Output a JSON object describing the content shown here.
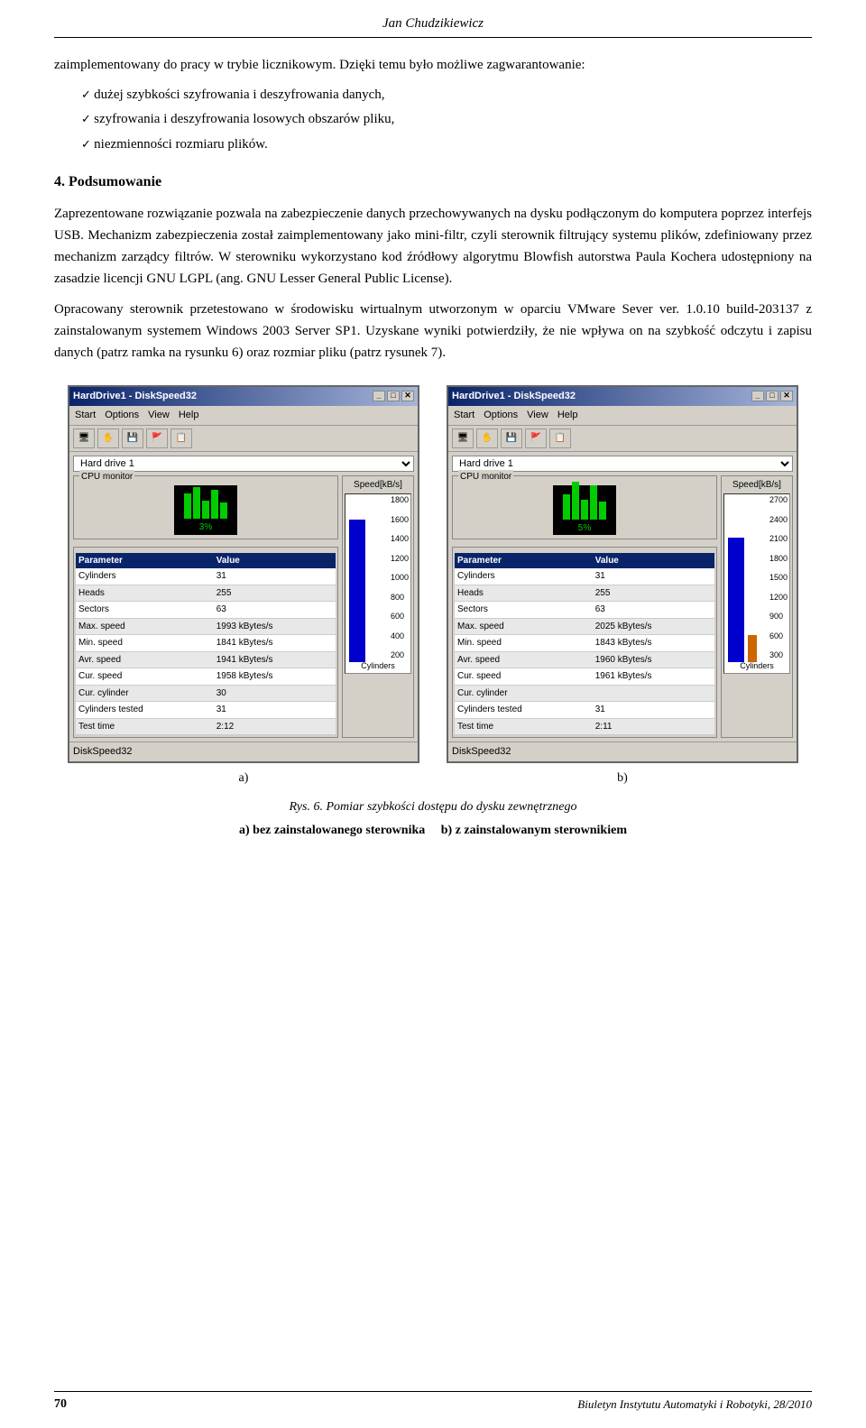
{
  "header": {
    "author": "Jan Chudzikiewicz"
  },
  "intro_text": "zaimplementowany do pracy w trybie licznikowym. Dzięki temu było możliwe zagwarantowanie:",
  "checklist": [
    "dużej szybkości szyfrowania i deszyfrowania danych,",
    "szyfrowania i deszyfrowania losowych obszarów pliku,",
    "niezmienności rozmiaru plików."
  ],
  "section": {
    "number": "4.",
    "title": "Podsumowanie"
  },
  "paragraphs": [
    "Zaprezentowane rozwiązanie pozwala na zabezpieczenie danych przechowywanych na dysku podłączonym do komputera poprzez interfejs USB. Mechanizm zabezpieczenia został zaimplementowany jako mini-filtr, czyli sterownik filtrujący systemu plików, zdefiniowany przez mechanizm zarządcy filtrów. W sterowniku wykorzystano kod źródłowy algorytmu Blowfish autorstwa Paula Kochera udostępniony na zasadzie licencji GNU LGPL (ang. GNU Lesser General Public License).",
    "Opracowany sterownik przetestowano w środowisku wirtualnym utworzonym w oparciu VMware Sever ver. 1.0.10 build-203137 z zainstalowanym systemem Windows 2003 Server SP1. Uzyskane wyniki potwierdziły, że nie wpływa on na szybkość odczytu i zapisu danych (patrz ramka na rysunku 6) oraz rozmiar pliku (patrz rysunek 7)."
  ],
  "figure_a": {
    "title": "HardDrive1 - DiskSpeed32",
    "menubar": [
      "Start",
      "Options",
      "View",
      "Help"
    ],
    "drive": "Hard drive 1",
    "cpu_percent": "3%",
    "cpu_bars": [
      28,
      35,
      20,
      32,
      18
    ],
    "table_headers": [
      "Parameter",
      "Value"
    ],
    "table_rows": [
      [
        "Cylinders",
        "31"
      ],
      [
        "Heads",
        "255"
      ],
      [
        "Sectors",
        "63"
      ],
      [
        "Max. speed",
        "1993 kBytes/s"
      ],
      [
        "Min. speed",
        "1841 kBytes/s"
      ],
      [
        "Avr. speed",
        "1941 kBytes/s"
      ],
      [
        "Cur. speed",
        "1958 kBytes/s"
      ],
      [
        "Cur. cylinder",
        "30"
      ],
      [
        "Cylinders tested",
        "31"
      ],
      [
        "Test time",
        "2:12"
      ]
    ],
    "speed_labels": [
      "1800",
      "1600",
      "1400",
      "1200",
      "1000",
      "800",
      "600",
      "400",
      "200"
    ],
    "speed_axis": "Speed[kB/s]",
    "x_axis": "Cylinders",
    "statusbar": "DiskSpeed32",
    "label": "a)"
  },
  "figure_b": {
    "title": "HardDrive1 - DiskSpeed32",
    "menubar": [
      "Start",
      "Options",
      "View",
      "Help"
    ],
    "drive": "Hard drive 1",
    "cpu_percent": "5%",
    "cpu_bars": [
      28,
      42,
      22,
      38,
      20
    ],
    "table_headers": [
      "Parameter",
      "Value"
    ],
    "table_rows": [
      [
        "Cylinders",
        "31"
      ],
      [
        "Heads",
        "255"
      ],
      [
        "Sectors",
        "63"
      ],
      [
        "Max. speed",
        "2025 kBytes/s"
      ],
      [
        "Min. speed",
        "1843 kBytes/s"
      ],
      [
        "Avr. speed",
        "1960 kBytes/s"
      ],
      [
        "Cur. speed",
        "1961 kBytes/s"
      ],
      [
        "Cur. cylinder",
        ""
      ],
      [
        "Cylinders tested",
        "31"
      ],
      [
        "Test time",
        "2:11"
      ]
    ],
    "speed_labels": [
      "2700",
      "2400",
      "2100",
      "1800",
      "1500",
      "1200",
      "900",
      "600",
      "300"
    ],
    "speed_axis": "Speed[kB/s]",
    "x_axis": "Cylinders",
    "statusbar": "DiskSpeed32",
    "label": "b)"
  },
  "caption": {
    "rys": "Rys. 6.",
    "title": "Pomiar szybkości dostępu do dysku zewnętrznego",
    "sub_a": "a) bez zainstalowanego sterownika",
    "sub_b": "b) z zainstalowanym sterownikiem"
  },
  "footer": {
    "page": "70",
    "journal": "Biuletyn Instytutu Automatyki i Robotyki, 28/2010"
  }
}
